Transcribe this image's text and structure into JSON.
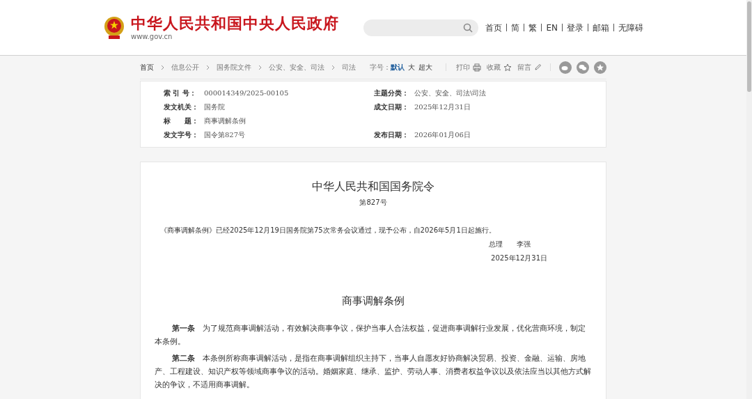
{
  "header": {
    "site_title": "中华人民共和国中央人民政府",
    "site_url": "www.gov.cn",
    "nav": [
      "首页",
      "简",
      "繁",
      "EN",
      "登录",
      "邮箱",
      "无障碍"
    ]
  },
  "breadcrumb": [
    "首页",
    "信息公开",
    "国务院文件",
    "公安、安全、司法",
    "司法"
  ],
  "toolbar": {
    "font_label": "字号：",
    "font_sizes": [
      {
        "label": "默认",
        "selected": true
      },
      {
        "label": "大",
        "selected": false
      },
      {
        "label": "超大",
        "selected": false
      }
    ],
    "print": "打印",
    "favorite": "收藏",
    "comment": "留言"
  },
  "info": [
    [
      {
        "label": "索 引 号：",
        "value": "000014349/2025-00105"
      },
      {
        "label": "主题分类：",
        "value": "公安、安全、司法\\司法"
      }
    ],
    [
      {
        "label": "发文机关：",
        "value": "国务院"
      },
      {
        "label": "成文日期：",
        "value": "2025年12月31日"
      }
    ],
    [
      {
        "label": "标　　题：",
        "value": "商事调解条例"
      }
    ],
    [
      {
        "label": "发文字号：",
        "value": "国令第827号"
      },
      {
        "label": "发布日期：",
        "value": "2026年01月06日"
      }
    ]
  ],
  "article": {
    "order_title": "中华人民共和国国务院令",
    "order_number": "第827号",
    "announcement": "《商事调解条例》已经2025年12月19日国务院第75次常务会议通过，现予公布，自2026年5月1日起施行。",
    "signer": "总理　　李强",
    "sign_date": "2025年12月31日",
    "regulation_title": "商事调解条例",
    "paragraphs": [
      "**第一条**　为了规范商事调解活动，有效解决商事争议，保护当事人合法权益，促进商事调解行业发展，优化营商环境，制定本条例。",
      "**第二条**　本条例所称商事调解活动，是指在商事调解组织主持下，当事人自愿友好协商解决贸易、投资、金融、运输、房地产、工程建设、知识产权等领域商事争议的活动。婚姻家庭、继承、监护、劳动人事、消费者权益争议以及依法应当以其他方式解决的争议，不适用商事调解。"
    ]
  }
}
